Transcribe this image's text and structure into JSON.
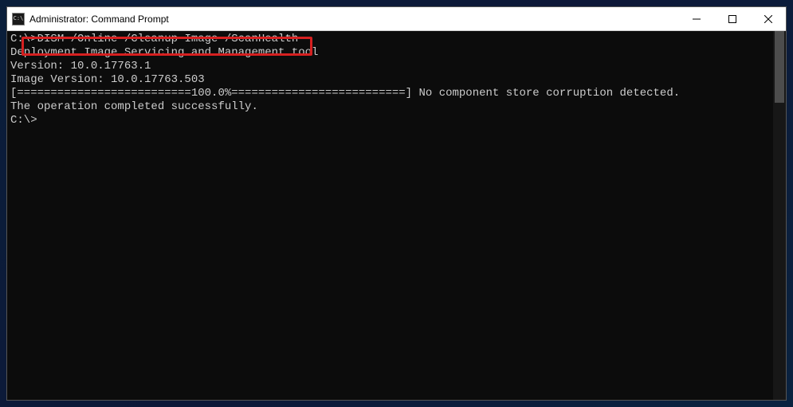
{
  "window": {
    "title": "Administrator: Command Prompt",
    "icon_label": "C:\\"
  },
  "terminal": {
    "prompt1": "C:\\>",
    "command1": "DISM /Online /Cleanup-Image /ScanHealth",
    "blank": "",
    "out_tool": "Deployment Image Servicing and Management tool",
    "out_version": "Version: 10.0.17763.1",
    "out_image_version": "Image Version: 10.0.17763.503",
    "out_progress": "[==========================100.0%==========================] No component store corruption detected.",
    "out_success": "The operation completed successfully.",
    "prompt2": "C:\\>"
  }
}
